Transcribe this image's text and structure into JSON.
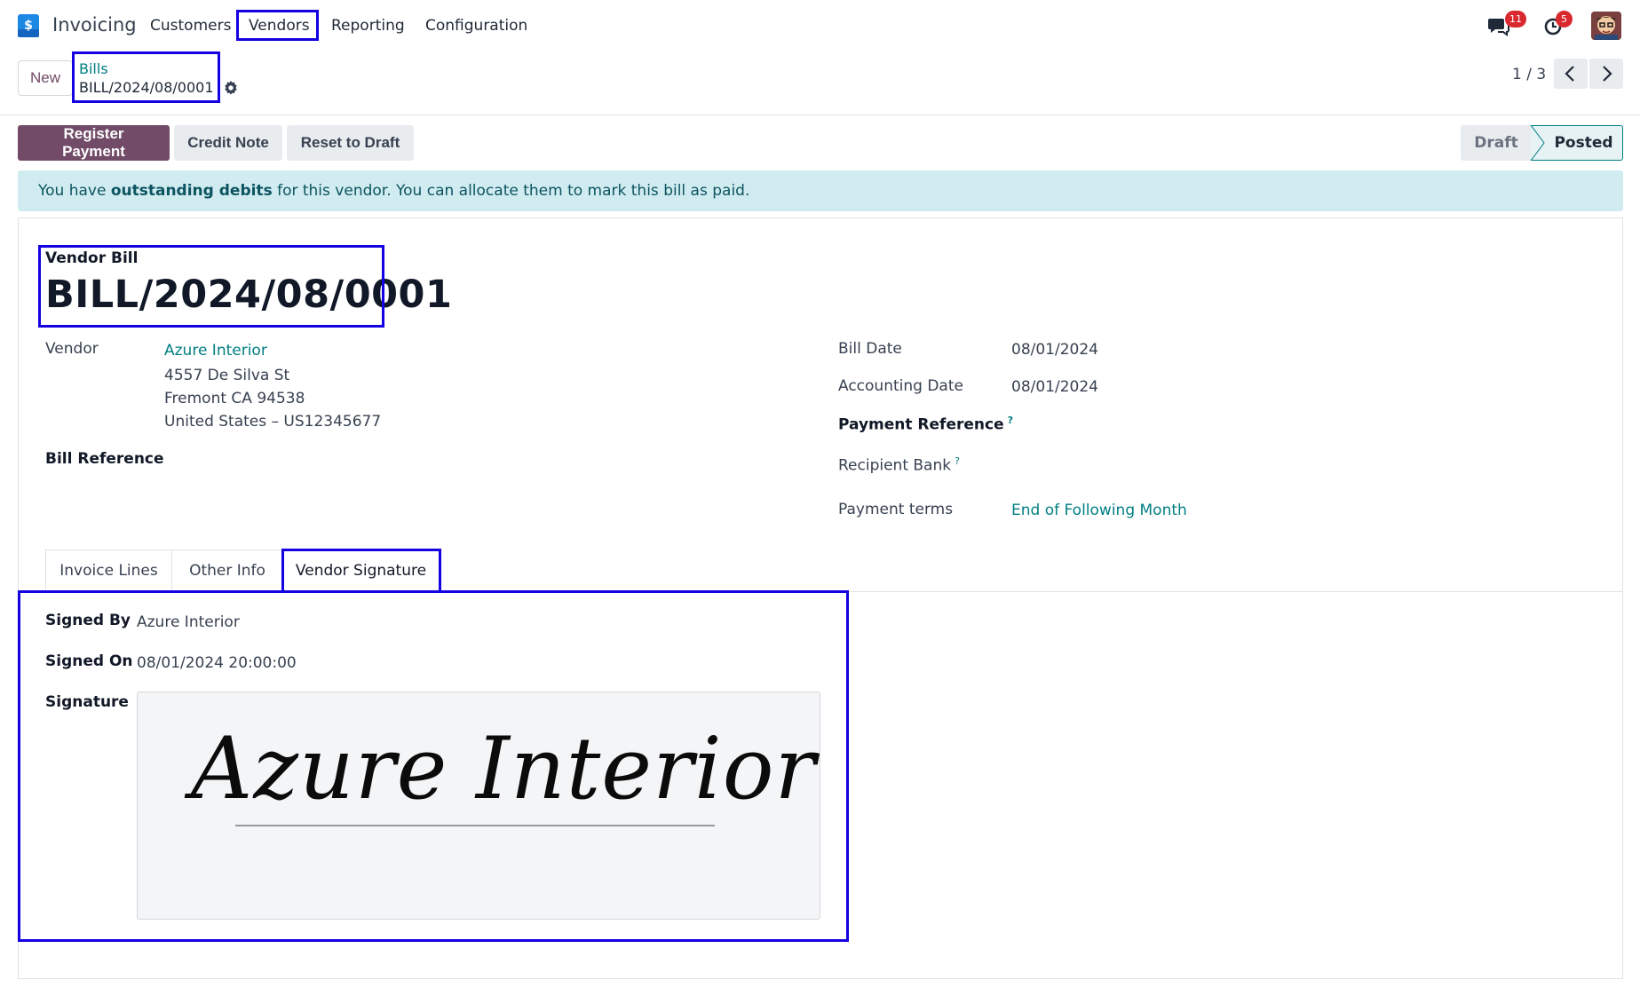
{
  "navbar": {
    "app_name": "Invoicing",
    "menu": [
      "Customers",
      "Vendors",
      "Reporting",
      "Configuration"
    ],
    "messages_count": "11",
    "activities_count": "5"
  },
  "control_panel": {
    "new_label": "New",
    "breadcrumb_parent": "Bills",
    "breadcrumb_current": "BILL/2024/08/0001",
    "pager": "1 / 3"
  },
  "actions": {
    "register_payment": "Register Payment",
    "credit_note": "Credit Note",
    "reset_to_draft": "Reset to Draft"
  },
  "status": {
    "draft": "Draft",
    "posted": "Posted"
  },
  "alert": {
    "prefix": "You have ",
    "strong": "outstanding debits",
    "suffix": " for this vendor. You can allocate them to mark this bill as paid."
  },
  "form": {
    "type_label": "Vendor Bill",
    "name": "BILL/2024/08/0001",
    "vendor_label": "Vendor",
    "vendor_name": "Azure Interior",
    "vendor_address_1": "4557 De Silva St",
    "vendor_address_2": "Fremont CA 94538",
    "vendor_address_3": "United States – US12345677",
    "bill_reference_label": "Bill Reference",
    "bill_date_label": "Bill Date",
    "bill_date": "08/01/2024",
    "accounting_date_label": "Accounting Date",
    "accounting_date": "08/01/2024",
    "payment_reference_label": "Payment Reference",
    "recipient_bank_label": "Recipient Bank",
    "help_mark": "?",
    "payment_terms_label": "Payment terms",
    "payment_terms": "End of Following Month"
  },
  "tabs": [
    "Invoice Lines",
    "Other Info",
    "Vendor Signature"
  ],
  "signature_tab": {
    "signed_by_label": "Signed By",
    "signed_by": "Azure Interior",
    "signed_on_label": "Signed On",
    "signed_on": "08/01/2024 20:00:00",
    "signature_label": "Signature",
    "signature_text": "Azure Interior"
  },
  "colors": {
    "brand": "#714b67",
    "link": "#017e84",
    "highlight": "#1400e0"
  }
}
